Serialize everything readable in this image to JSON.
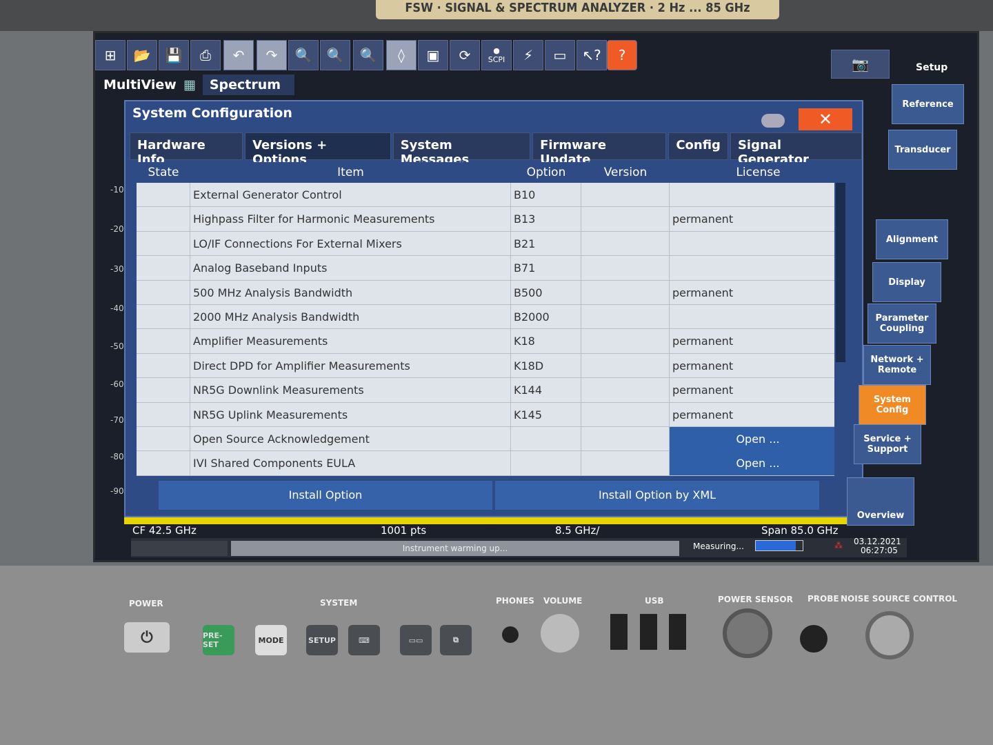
{
  "device": {
    "model_label": "FSW · SIGNAL & SPECTRUM ANALYZER · 2 Hz ... 85 GHz"
  },
  "toolbar": {
    "icons": [
      "windows-icon",
      "open-folder-icon",
      "save-icon",
      "print-icon",
      "undo-icon",
      "redo-icon",
      "zoom-icon",
      "multi-zoom-icon",
      "zoom-off-icon",
      "marker-icon",
      "fullscreen-icon",
      "sequencer-icon",
      "scpi-icon",
      "connect-icon",
      "display-icon",
      "context-help-icon",
      "help-icon"
    ],
    "scpi_label": "SCPI",
    "setup_label": "Setup"
  },
  "channel_tabs": {
    "multiview": "MultiView",
    "spectrum": "Spectrum"
  },
  "dialog": {
    "title": "System Configuration",
    "tabs": [
      "Hardware Info",
      "Versions + Options",
      "System Messages",
      "Firmware Update",
      "Config",
      "Signal Generator"
    ],
    "active_tab": "Versions + Options",
    "columns": [
      "State",
      "Item",
      "Option",
      "Version",
      "License"
    ],
    "rows": [
      {
        "item": "External Generator Control",
        "option": "B10",
        "version": "",
        "license": ""
      },
      {
        "item": "Highpass Filter for Harmonic Measurements",
        "option": "B13",
        "version": "",
        "license": "permanent"
      },
      {
        "item": "LO/IF Connections For External Mixers",
        "option": "B21",
        "version": "",
        "license": ""
      },
      {
        "item": "Analog Baseband Inputs",
        "option": "B71",
        "version": "",
        "license": ""
      },
      {
        "item": "500 MHz Analysis Bandwidth",
        "option": "B500",
        "version": "",
        "license": "permanent"
      },
      {
        "item": "2000 MHz Analysis Bandwidth",
        "option": "B2000",
        "version": "",
        "license": ""
      },
      {
        "item": "Amplifier Measurements",
        "option": "K18",
        "version": "",
        "license": "permanent"
      },
      {
        "item": "Direct DPD for Amplifier Measurements",
        "option": "K18D",
        "version": "",
        "license": "permanent"
      },
      {
        "item": "NR5G Downlink Measurements",
        "option": "K144",
        "version": "",
        "license": "permanent"
      },
      {
        "item": "NR5G Uplink Measurements",
        "option": "K145",
        "version": "",
        "license": "permanent"
      },
      {
        "item": "Open Source Acknowledgement",
        "option": "",
        "version": "",
        "license": "Open ..."
      },
      {
        "item": "IVI Shared Components EULA",
        "option": "",
        "version": "",
        "license": "Open ..."
      }
    ],
    "install_option": "Install Option",
    "install_option_xml": "Install Option by XML"
  },
  "softkeys": [
    "Reference",
    "Transducer",
    "Alignment",
    "Display",
    "Parameter Coupling",
    "Network + Remote",
    "System Config",
    "Service + Support",
    "Overview"
  ],
  "active_softkey": "System Config",
  "y_axis": [
    "-10",
    "-20",
    "-30",
    "-40",
    "-50",
    "-60",
    "-70",
    "-80",
    "-90"
  ],
  "trace_status": {
    "cf": "CF 42.5 GHz",
    "points": "1001 pts",
    "div": "8.5 GHz/",
    "span": "Span 85.0 GHz"
  },
  "status_bar": {
    "message": "Instrument warming up...",
    "measuring": "Measuring...",
    "progress": 0.85,
    "date": "03.12.2021",
    "time": "06:27:05"
  },
  "front_panel": {
    "power": "POWER",
    "system": "SYSTEM",
    "phones": "PHONES",
    "volume": "VOLUME",
    "usb": "USB",
    "power_sensor": "POWER SENSOR",
    "probe": "PROBE",
    "noise_source": "NOISE SOURCE CONTROL",
    "preset": "PRE-SET",
    "mode": "MODE",
    "setup": "SETUP"
  },
  "colors": {
    "accent": "#2f4b86",
    "highlight": "#f05a24",
    "trace": "#e8d400"
  }
}
